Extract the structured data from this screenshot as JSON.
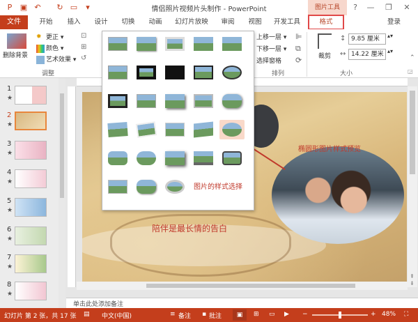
{
  "titlebar": {
    "title": "情侣照片视频片头制作 - PowerPoint",
    "context_group": "图片工具",
    "minimize": "—",
    "restore": "❐",
    "help": "?",
    "close": "✕"
  },
  "tabs": {
    "file": "文件",
    "items": [
      "开始",
      "插入",
      "设计",
      "切换",
      "动画",
      "幻灯片放映",
      "审阅",
      "视图",
      "开发工具"
    ],
    "active": "格式",
    "login": "登录"
  },
  "ribbon": {
    "adjust": {
      "remove_bg": "删除背景",
      "corrections": "更正",
      "color": "颜色",
      "artistic": "艺术效果",
      "label": "调整"
    },
    "arrange": {
      "bring_forward": "上移一层",
      "send_backward": "下移一层",
      "selection_pane": "选择窗格",
      "label": "排列"
    },
    "size": {
      "crop": "裁剪",
      "height": "9.85 厘米",
      "width": "14.22 厘米",
      "label": "大小"
    }
  },
  "slides": {
    "numbers": [
      "1",
      "2",
      "3",
      "4",
      "5",
      "6",
      "7",
      "8"
    ],
    "star": "★",
    "selected_index": 2
  },
  "slide": {
    "main_text": "陪伴是最长情的告白",
    "oval_caption": "椭圆形图片样式预览",
    "gallery_caption": "图片的样式选择"
  },
  "notes": {
    "placeholder": "单击此处添加备注"
  },
  "status": {
    "slide_info": "幻灯片 第 2 张，共 17 张",
    "language": "中文(中国)",
    "notes_btn": "备注",
    "comments_btn": "批注",
    "zoom": "48%"
  },
  "colors": {
    "accent": "#c43e1c",
    "highlight_border": "#e04848",
    "annotation_text": "#c0392b"
  }
}
